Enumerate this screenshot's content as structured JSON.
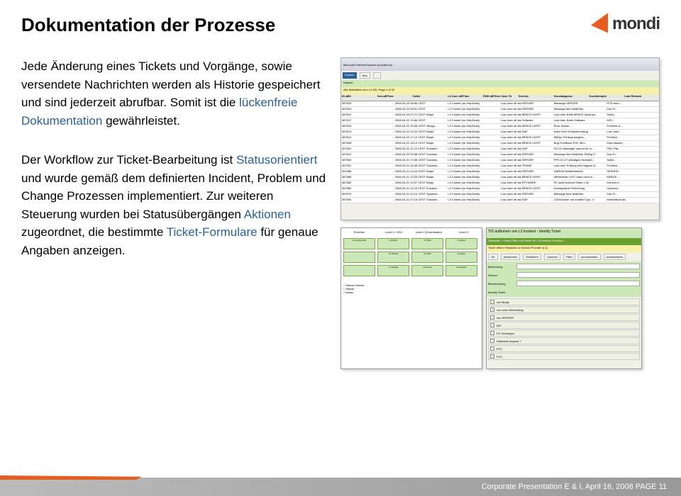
{
  "header": {
    "title": "Dokumentation der Prozesse",
    "logo_text": "mondi"
  },
  "para1": {
    "t1": "Jede Änderung eines Tickets und Vorgänge, sowie versendete Nachrichten werden als Historie gespeichert und sind jederzeit abrufbar. Somit ist die ",
    "h1": "lückenfreie Dokumentation",
    "t2": " gewährleistet."
  },
  "para2": {
    "t1": "Der Workflow zur Ticket-Bearbeitung ist ",
    "h1": "Statusorientiert",
    "t2": " und wurde gemäß dem definierten Incident, Problem und Change Prozessen implementiert. Zur weiteren Steuerung wurden bei Statusübergängen ",
    "h2": "Aktionen",
    "t3": " zugeordnet, die bestimmte ",
    "h3": "Ticket-Formulare",
    "t4": " für genaue  Angaben anzeigen."
  },
  "screenshot1": {
    "window_title": "Microsoft Internet Explorer provided by ...",
    "btn_search": "Suchen",
    "btn_new": "Neu",
    "tab_label": "Historie",
    "listing_title": "Alle Aktivitäten zum L3-HD; Page 1 of 32",
    "headers": [
      "ID-aBC",
      "Von-aBTime",
      "Caller",
      "L3 User aBTime",
      "END aBTime Case To",
      "Service",
      "Kurzdiagnose",
      "Kurztherapie",
      "Last Remark"
    ],
    "rows": [
      [
        "387626",
        "2008-04-23 08:56 CEST",
        "L3 Closed (no HelpDesk)",
        "Low User oft als SERVER",
        "Message SERVER",
        "PCR auto..."
      ],
      [
        "387624",
        "2008-04-23 08:51 CEST",
        "L3 Closed (no HelpDesk)",
        "Low User oft als SERVER",
        "Message Item MailHelp",
        "Das Fr..."
      ],
      [
        "387622",
        "2008-04-23 07:21 CEST Bubje",
        "L3 Closed (no HelpDesk)",
        "Low User oft als MPACE-HOST",
        "Low User limits MPACE anschau..",
        "Softw..."
      ],
      [
        "387617",
        "2008-04-22 19:46 CEST",
        "L3 Closed (no HelpDesk)",
        "Low User oft als Software",
        "Low User limits Software",
        "KlRi..."
      ],
      [
        "387615",
        "2008-04-22 19:08 CEST Neuge...",
        "L3 Closed (no HelpDesk)",
        "Low User oft als MPACE-HOST",
        "Error invoke...",
        "Problem w..."
      ],
      [
        "387614",
        "2008-04-22 19:22 CEST Bubje",
        "L3 Closed (no HelpDesk)",
        "Low User oft als SAP",
        "Kann nicht Softwarevollzug",
        "Low User..."
      ],
      [
        "387612",
        "2008-04-22 17:12 CEST Bubje",
        "L3 Closed (no HelpDesk)",
        "Low User oft als MPACE-HOST",
        "MitOpr Fehlerausregeln...",
        "Problem..."
      ],
      [
        "387608",
        "2008-04-22 16:14 CEST Bubje",
        "L3 Closed (no HelpDesk)",
        "Low User oft als MPACE-HOST",
        "Bug Feedback ESC Item",
        "Kann fassen..."
      ],
      [
        "387602",
        "2008-04-22 11:10 CEST Sundare...",
        "L3 Closed (no HelpDesk)",
        "Low User oft als SAP",
        "FG-01 Wissinger cannot be m...",
        "FM1 Plat..."
      ],
      [
        "387601",
        "2008-04-22 09:38 CEST Sundare...",
        "L3 Closed (no HelpDesk)",
        "Low User oft als SERVER",
        "Message Item MailHelp Stding IT",
        "Das Fr..."
      ],
      [
        "387600",
        "2008-04-21 17:08 CEST Sundare...",
        "L3 Closed (no HelpDesk)",
        "Low User oft als SERVER",
        "PPS-01-07 ständiges Neustart...",
        "Softw..."
      ],
      [
        "387591",
        "2008-04-21 16:48 CEST Sundare...",
        "L3 Closed (no HelpDesk)",
        "Low User oft als TRANS",
        "Low User Prüfung mit Eingabe In...",
        "Problem..."
      ],
      [
        "387588",
        "2008-04-21 14:16 CEST Bubje",
        "L3 Closed (no HelpDesk)",
        "Low User oft als SERVER",
        "HARDW Betriebsbereit",
        "SERVER..."
      ],
      [
        "387585",
        "2008-04-21 13:25 CEST Bubje",
        "L3 Closed (no HelpDesk)",
        "Low User oft als MPACE-HOST",
        "Werkschein 0107 kann nicht In...",
        "MPACE-..."
      ],
      [
        "387582",
        "2008-04-21 12:57 CEST Bubje",
        "L3 Closed (no HelpDesk)",
        "Low User oft als SPTWARE",
        "PC start incident Softw 1.0s",
        "Kommt m..."
      ],
      [
        "387580",
        "2008-04-21 11:15 CEST Sundare...",
        "L3 Closed (no HelpDesk)",
        "Low User oft als MPACE-HOST",
        "Ausreguliere Einrichtung",
        "Operator..."
      ],
      [
        "387579",
        "2008-04-21 10:10 CEST Systems...",
        "L3 Closed (no HelpDesk)",
        "Low User oft als SERVER",
        "Message Item MailHelp",
        "Das Fr..."
      ],
      [
        "387560",
        "2008-04-21 07:18 CEST Sundare...",
        "L3 Closed (no HelpDesk)",
        "Low User oft als SAP",
        "2.500/closer not created Typi...e",
        "bestDefault da..."
      ]
    ]
  },
  "screenshot2": {
    "cols": [
      "EndUser",
      "Level 1 / HDC",
      "Level 2 (Koordinator)",
      "Level 3"
    ],
    "boxes": [
      "Incoming Call",
      "L1-Open",
      "L2>Dta",
      "L3-Open",
      "",
      "L1-Solved",
      "L2>Dta",
      "L2-Open",
      "",
      "L1-Closed",
      "L2>Close",
      "L3-Closed"
    ],
    "legend": [
      "Status Checks",
      "Status",
      "Action"
    ]
  },
  "screenshot3": {
    "title": "TID aufbohren von L3 Incident - Identify Ticket",
    "breadcrumb": "Startseite > Ticket-Filter und Werte für L3-Incident Provider L...",
    "scenario": "Ticket öffnen Helpdesk to Service-Provider (L3)",
    "fields": [
      {
        "label": "Bemerkung",
        "value": ""
      },
      {
        "label": "Service",
        "value": ""
      },
      {
        "label": "Beschreibung",
        "value": ""
      }
    ],
    "items_label": "Identify Ticket",
    "items": [
      "von Bubje",
      "von einer Einrichtung",
      "von SERVER",
      "INC",
      "PC Developer",
      "Helpdesk request ?",
      "PC2",
      "PC3"
    ],
    "buttons": [
      "OK",
      "Abbrechen",
      "Schließen",
      "Löschen",
      "Filter",
      "zurücksetzen",
      "zurücksetzen"
    ]
  },
  "footer": {
    "text": "Corporate Presentation E & I, April 16, 2008 PAGE 11"
  }
}
